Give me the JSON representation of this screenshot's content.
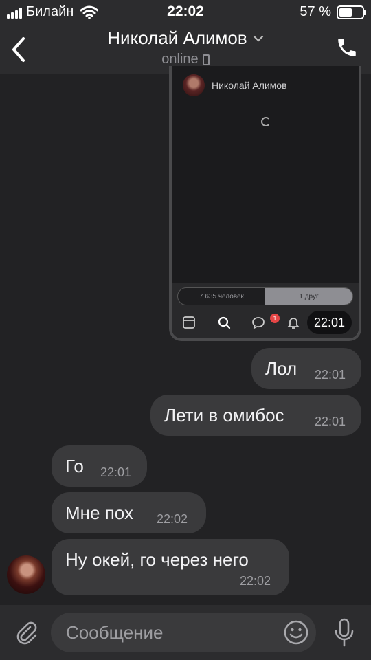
{
  "status_bar": {
    "carrier": "Билайн",
    "time": "22:02",
    "battery_percent": "57 %",
    "battery_level": 0.57
  },
  "header": {
    "title": "Николай Алимов",
    "subtitle": "online"
  },
  "shared_screenshot": {
    "contact_name": "Николай Алимов",
    "tab_people": "7 635 человек",
    "tab_friends": "1 друг",
    "notification_count": "1",
    "time": "22:01"
  },
  "messages": [
    {
      "text": "Лол",
      "time": "22:01",
      "outgoing": true
    },
    {
      "text": "Лети в омибос",
      "time": "22:01",
      "outgoing": true
    },
    {
      "text": "Го",
      "time": "22:01",
      "outgoing": false
    },
    {
      "text": "Мне пох",
      "time": "22:02",
      "outgoing": false
    },
    {
      "text": "Ну окей, го через него",
      "time": "22:02",
      "outgoing": false
    }
  ],
  "input": {
    "placeholder": "Сообщение"
  },
  "icons": {
    "back": "chevron-left-icon",
    "call": "phone-icon",
    "attach": "paperclip-icon",
    "emoji": "smiley-icon",
    "mic": "microphone-icon"
  }
}
